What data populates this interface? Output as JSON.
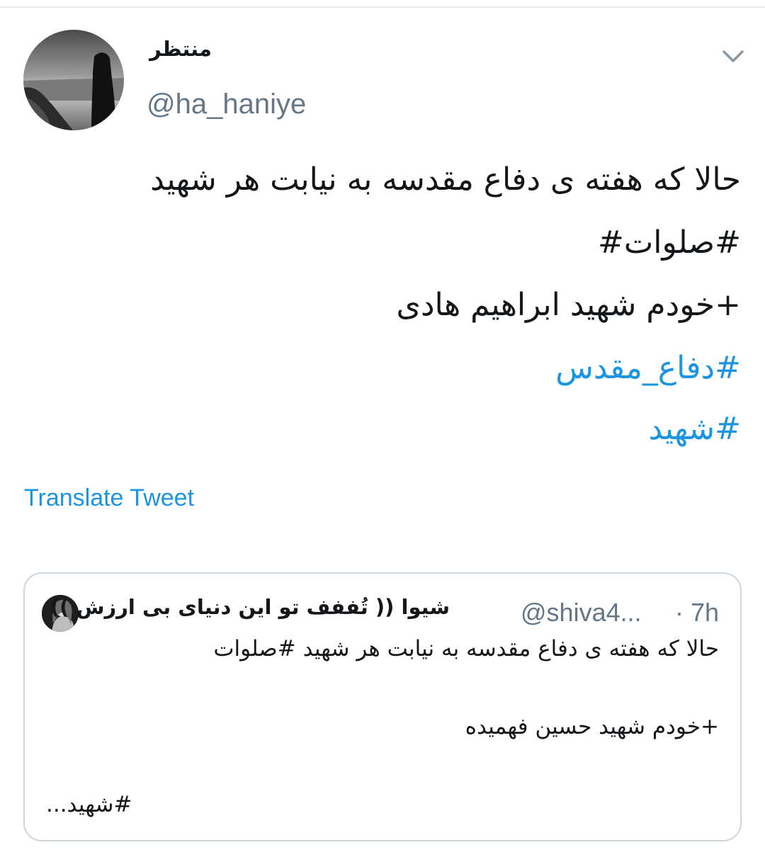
{
  "author": {
    "display_name": "منتظر",
    "handle": "@ha_haniye",
    "avatar_icon": "avatar-silhouette-at-sea"
  },
  "menu": {
    "icon": "chevron-down-icon"
  },
  "tweet": {
    "lines": [
      "حالا که هفته ی دفاع مقدسه به نیابت هر شهید",
      "#صلوات#",
      "+خودم شهید ابراهیم هادی",
      "#دفاع_مقدس",
      "#شهید"
    ]
  },
  "translate_label": "Translate Tweet",
  "quoted": {
    "display_name": "شیوا (( تُففف تو این دنیای بی ارزش ))",
    "handle": "@shiva4...",
    "time": "· 7h",
    "lines": [
      "حالا که هفته ی دفاع مقدسه به نیابت هر شهید #صلوات",
      "",
      "+خودم شهید حسین فهمیده",
      "#شهید..."
    ]
  },
  "colors": {
    "link": "#1b95e0",
    "muted": "#657786",
    "border": "#ccd6dd",
    "text": "#14171a"
  }
}
